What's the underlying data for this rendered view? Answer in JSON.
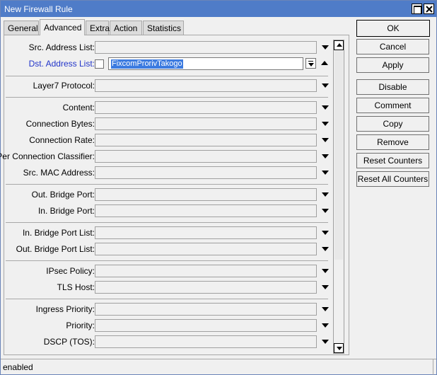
{
  "window": {
    "title": "New Firewall Rule"
  },
  "tabs": [
    {
      "label": "General"
    },
    {
      "label": "Advanced"
    },
    {
      "label": "Extra"
    },
    {
      "label": "Action"
    },
    {
      "label": "Statistics"
    }
  ],
  "form": {
    "src_address_list": {
      "label": "Src. Address List:",
      "value": ""
    },
    "dst_address_list": {
      "label": "Dst. Address List:",
      "value": "FixcomProrivTakogo"
    },
    "layer7_protocol": {
      "label": "Layer7 Protocol:",
      "value": ""
    },
    "content": {
      "label": "Content:",
      "value": ""
    },
    "connection_bytes": {
      "label": "Connection Bytes:",
      "value": ""
    },
    "connection_rate": {
      "label": "Connection Rate:",
      "value": ""
    },
    "per_connection_classifier": {
      "label": "Per Connection Classifier:",
      "value": ""
    },
    "src_mac_address": {
      "label": "Src. MAC Address:",
      "value": ""
    },
    "out_bridge_port": {
      "label": "Out. Bridge Port:",
      "value": ""
    },
    "in_bridge_port": {
      "label": "In. Bridge Port:",
      "value": ""
    },
    "in_bridge_port_list": {
      "label": "In. Bridge Port List:",
      "value": ""
    },
    "out_bridge_port_list": {
      "label": "Out. Bridge Port List:",
      "value": ""
    },
    "ipsec_policy": {
      "label": "IPsec Policy:",
      "value": ""
    },
    "tls_host": {
      "label": "TLS Host:",
      "value": ""
    },
    "ingress_priority": {
      "label": "Ingress Priority:",
      "value": ""
    },
    "priority": {
      "label": "Priority:",
      "value": ""
    },
    "dscp_tos": {
      "label": "DSCP (TOS):",
      "value": ""
    }
  },
  "buttons": {
    "ok": "OK",
    "cancel": "Cancel",
    "apply": "Apply",
    "disable": "Disable",
    "comment": "Comment",
    "copy": "Copy",
    "remove": "Remove",
    "reset_counters": "Reset Counters",
    "reset_all_counters": "Reset All Counters"
  },
  "status": {
    "text": "enabled"
  },
  "colors": {
    "titlebar": "#4f7cc8",
    "selection": "#3c7be0",
    "dst_label": "#2235c9"
  }
}
